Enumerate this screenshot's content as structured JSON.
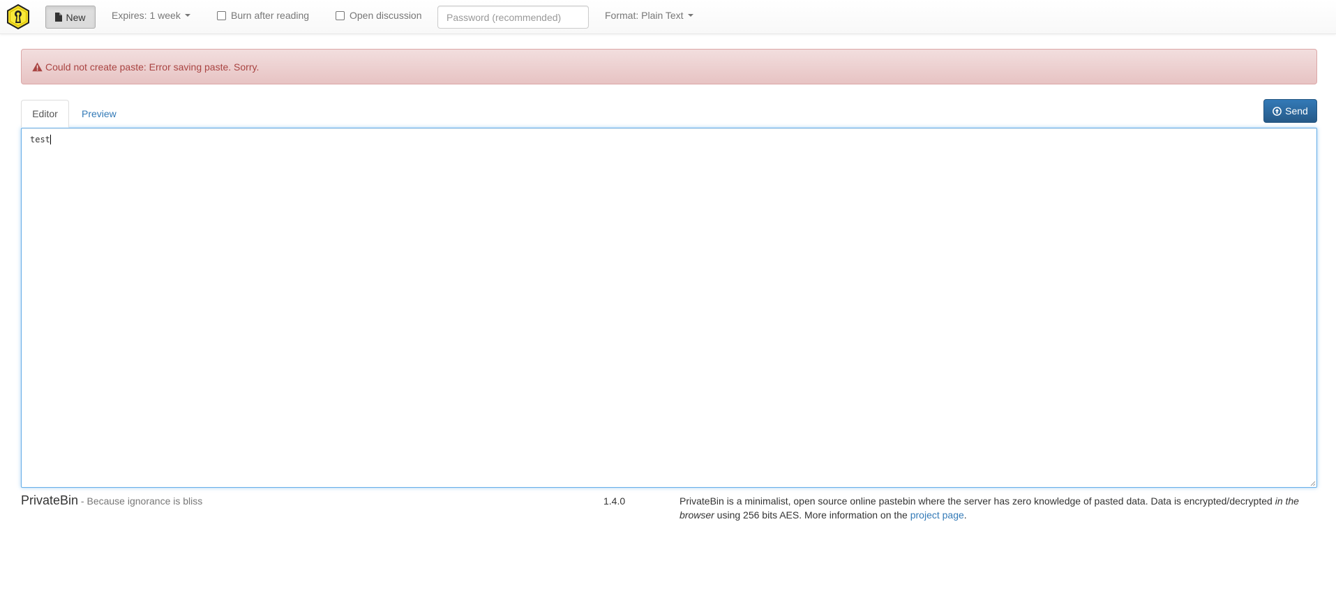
{
  "app": {
    "name": "PrivateBin"
  },
  "navbar": {
    "new_label": "New",
    "expires_label": "Expires: 1 week",
    "burn_label": "Burn after reading",
    "burn_checked": false,
    "discussion_label": "Open discussion",
    "discussion_checked": false,
    "password_placeholder": "Password (recommended)",
    "password_value": "",
    "format_label": "Format: Plain Text"
  },
  "alert": {
    "message": "Could not create paste: Error saving paste. Sorry."
  },
  "tabs": {
    "editor_label": "Editor",
    "preview_label": "Preview",
    "active": "Editor"
  },
  "send_label": "Send",
  "editor": {
    "content": "test"
  },
  "footer": {
    "brand": "PrivateBin",
    "tagline": " - Because ignorance is bliss",
    "version": "1.4.0",
    "about_part1": "PrivateBin is a minimalist, open source online pastebin where the server has zero knowledge of pasted data. Data is encrypted/decrypted ",
    "about_em": "in the browser",
    "about_part2": " using 256 bits AES. More information on the ",
    "about_link": "project page",
    "about_end": "."
  },
  "colors": {
    "alert_text": "#a94442",
    "alert_bg": "#f2dede",
    "primary": "#337ab7",
    "logo_yellow": "#f5e028"
  },
  "icons": {
    "logo": "privatebin-keyhole-logo",
    "new": "file-icon",
    "alert": "warning-sign-icon",
    "send": "upload-circle-icon"
  }
}
